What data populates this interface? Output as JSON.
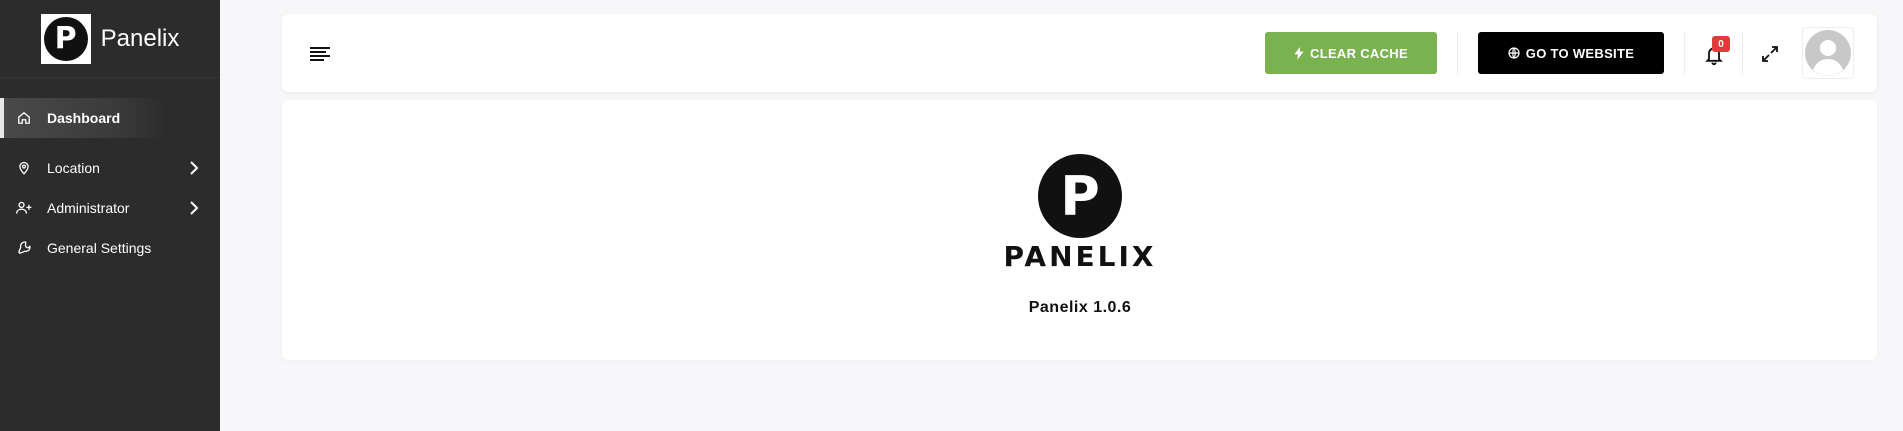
{
  "brand": {
    "name": "Panelix",
    "logo_letter": "P"
  },
  "sidebar": {
    "items": [
      {
        "label": "Dashboard",
        "icon": "home-icon",
        "active": true
      },
      {
        "label": "Location",
        "icon": "map-pin-icon",
        "has_submenu": true
      },
      {
        "label": "Administrator",
        "icon": "user-plus-icon",
        "has_submenu": true
      },
      {
        "label": "General Settings",
        "icon": "wrench-icon"
      }
    ]
  },
  "header": {
    "clear_cache_label": "CLEAR CACHE",
    "go_to_website_label": "GO TO WEBSITE",
    "notification_count": "0"
  },
  "main": {
    "logo_letter": "P",
    "logo_word": "PANELIX",
    "version_text": "Panelix 1.0.6"
  },
  "colors": {
    "sidebar_bg": "#2c2c2c",
    "clear_cache_bg": "#7ab250",
    "website_btn_bg": "#000000",
    "badge_bg": "#e03b3b"
  }
}
